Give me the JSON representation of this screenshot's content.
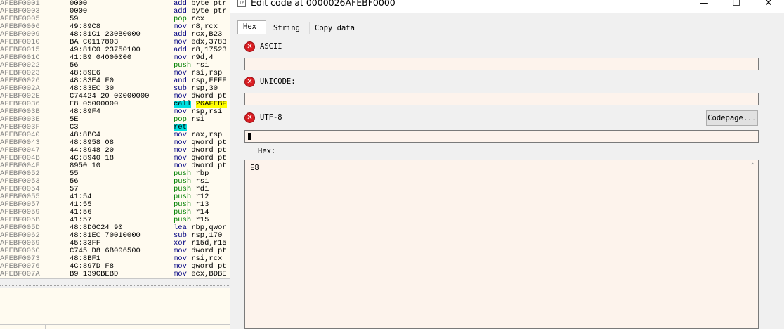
{
  "disasm": {
    "rows": [
      {
        "addr": "AFEBF0001",
        "bytes": "0000",
        "mnem": "add",
        "args": "byte ptr",
        "mclass": "m-add"
      },
      {
        "addr": "AFEBF0003",
        "bytes": "0000",
        "mnem": "add",
        "args": "byte ptr",
        "mclass": "m-add"
      },
      {
        "addr": "AFEBF0005",
        "bytes": "59",
        "mnem": "pop",
        "args": "rcx",
        "mclass": "m-pop"
      },
      {
        "addr": "AFEBF0006",
        "bytes": "49:89C8",
        "mnem": "mov",
        "args": "r8,rcx",
        "mclass": "m-mov"
      },
      {
        "addr": "AFEBF0009",
        "bytes": "48:81C1 230B0000",
        "mnem": "add",
        "args": "rcx,B23",
        "mclass": "m-add"
      },
      {
        "addr": "AFEBF0010",
        "bytes": "BA C0117803",
        "mnem": "mov",
        "args": "edx,3783",
        "mclass": "m-mov"
      },
      {
        "addr": "AFEBF0015",
        "bytes": "49:81C0 23750100",
        "mnem": "add",
        "args": "r8,17523",
        "mclass": "m-add"
      },
      {
        "addr": "AFEBF001C",
        "bytes": "41:B9 04000000",
        "mnem": "mov",
        "args": "r9d,4",
        "mclass": "m-mov"
      },
      {
        "addr": "AFEBF0022",
        "bytes": "56",
        "mnem": "push",
        "args": "rsi",
        "mclass": "m-push"
      },
      {
        "addr": "AFEBF0023",
        "bytes": "48:89E6",
        "mnem": "mov",
        "args": "rsi,rsp",
        "mclass": "m-mov"
      },
      {
        "addr": "AFEBF0026",
        "bytes": "48:83E4 F0",
        "mnem": "and",
        "args": "rsp,FFFF",
        "mclass": "m-and"
      },
      {
        "addr": "AFEBF002A",
        "bytes": "48:83EC 30",
        "mnem": "sub",
        "args": "rsp,30",
        "mclass": "m-sub"
      },
      {
        "addr": "AFEBF002E",
        "bytes": "C74424 20 00000000",
        "mnem": "mov",
        "args": "dword pt",
        "mclass": "m-mov"
      },
      {
        "addr": "AFEBF0036",
        "bytes": "E8 05000000",
        "mnem": "call",
        "args": "26AFEBF",
        "mclass": "m-call",
        "call": true
      },
      {
        "addr": "AFEBF003B",
        "bytes": "48:89F4",
        "mnem": "mov",
        "args": "rsp,rsi",
        "mclass": "m-mov"
      },
      {
        "addr": "AFEBF003E",
        "bytes": "5E",
        "mnem": "pop",
        "args": "rsi",
        "mclass": "m-pop"
      },
      {
        "addr": "AFEBF003F",
        "bytes": "C3",
        "mnem": "ret",
        "args": "",
        "mclass": "m-ret"
      },
      {
        "addr": "AFEBF0040",
        "bytes": "48:8BC4",
        "mnem": "mov",
        "args": "rax,rsp",
        "mclass": "m-mov"
      },
      {
        "addr": "AFEBF0043",
        "bytes": "48:8958 08",
        "mnem": "mov",
        "args": "qword pt",
        "mclass": "m-mov"
      },
      {
        "addr": "AFEBF0047",
        "bytes": "44:8948 20",
        "mnem": "mov",
        "args": "dword pt",
        "mclass": "m-mov"
      },
      {
        "addr": "AFEBF004B",
        "bytes": "4C:8940 18",
        "mnem": "mov",
        "args": "qword pt",
        "mclass": "m-mov"
      },
      {
        "addr": "AFEBF004F",
        "bytes": "8950 10",
        "mnem": "mov",
        "args": "dword pt",
        "mclass": "m-mov"
      },
      {
        "addr": "AFEBF0052",
        "bytes": "55",
        "mnem": "push",
        "args": "rbp",
        "mclass": "m-push"
      },
      {
        "addr": "AFEBF0053",
        "bytes": "56",
        "mnem": "push",
        "args": "rsi",
        "mclass": "m-push"
      },
      {
        "addr": "AFEBF0054",
        "bytes": "57",
        "mnem": "push",
        "args": "rdi",
        "mclass": "m-push"
      },
      {
        "addr": "AFEBF0055",
        "bytes": "41:54",
        "mnem": "push",
        "args": "r12",
        "mclass": "m-push"
      },
      {
        "addr": "AFEBF0057",
        "bytes": "41:55",
        "mnem": "push",
        "args": "r13",
        "mclass": "m-push"
      },
      {
        "addr": "AFEBF0059",
        "bytes": "41:56",
        "mnem": "push",
        "args": "r14",
        "mclass": "m-push"
      },
      {
        "addr": "AFEBF005B",
        "bytes": "41:57",
        "mnem": "push",
        "args": "r15",
        "mclass": "m-push"
      },
      {
        "addr": "AFEBF005D",
        "bytes": "48:8D6C24 90",
        "mnem": "lea",
        "args": "rbp,qwor",
        "mclass": "m-lea"
      },
      {
        "addr": "AFEBF0062",
        "bytes": "48:81EC 70010000",
        "mnem": "sub",
        "args": "rsp,170",
        "mclass": "m-sub"
      },
      {
        "addr": "AFEBF0069",
        "bytes": "45:33FF",
        "mnem": "xor",
        "args": "r15d,r15",
        "mclass": "m-xor"
      },
      {
        "addr": "AFEBF006C",
        "bytes": "C745 D8 6B006500",
        "mnem": "mov",
        "args": "dword pt",
        "mclass": "m-mov"
      },
      {
        "addr": "AFEBF0073",
        "bytes": "48:8BF1",
        "mnem": "mov",
        "args": "rsi,rcx",
        "mclass": "m-mov"
      },
      {
        "addr": "AFEBF0076",
        "bytes": "4C:897D F8",
        "mnem": "mov",
        "args": "qword pt",
        "mclass": "m-mov"
      },
      {
        "addr": "AFEBF007A",
        "bytes": "B9 139CBEBD",
        "mnem": "mov",
        "args": "ecx,BDBE",
        "mclass": "m-mov"
      }
    ]
  },
  "dialog": {
    "title": "Edit code at 0000026AFEBF0000",
    "title_icon": "16",
    "minimize_glyph": "—",
    "maximize_glyph": "☐",
    "close_glyph": "✕",
    "tabs": [
      {
        "label": "Hex"
      },
      {
        "label": "String"
      },
      {
        "label": "Copy data"
      }
    ],
    "error_icon_glyph": "✕",
    "ascii_label": "ASCII",
    "ascii_value": "",
    "unicode_label": "UNICODE:",
    "unicode_value": "",
    "utf8_label": "UTF-8",
    "utf8_value": "",
    "codepage_button": "Codepage...",
    "hex_label": "Hex:",
    "hex_value": "E8",
    "scroll_up_glyph": "⌃"
  }
}
